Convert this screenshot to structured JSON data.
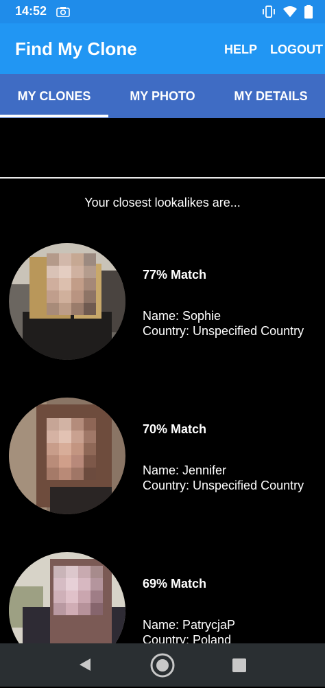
{
  "status": {
    "time": "14:52"
  },
  "app": {
    "title": "Find My Clone",
    "help": "HELP",
    "logout": "LOGOUT"
  },
  "tabs": [
    {
      "label": "MY CLONES",
      "selected": true
    },
    {
      "label": "MY PHOTO",
      "selected": false
    },
    {
      "label": "MY DETAILS",
      "selected": false
    }
  ],
  "main": {
    "heading": "Your closest lookalikes are...",
    "matches": [
      {
        "match": "77% Match",
        "name": "Name: Sophie",
        "country": "Country: Unspecified Country"
      },
      {
        "match": "70% Match",
        "name": "Name: Jennifer",
        "country": "Country: Unspecified Country"
      },
      {
        "match": "69% Match",
        "name": "Name: PatrycjaP",
        "country": "Country: Poland"
      }
    ]
  },
  "colors": {
    "status_bar": "#1f8cea",
    "app_bar": "#2196f3",
    "tab_bar": "#3f6cc4",
    "background": "#000000",
    "nav_bar": "#2a2f32"
  },
  "icons": [
    "camera-icon",
    "vibrate-icon",
    "wifi-icon",
    "battery-icon",
    "back-icon",
    "home-icon",
    "recents-icon"
  ]
}
